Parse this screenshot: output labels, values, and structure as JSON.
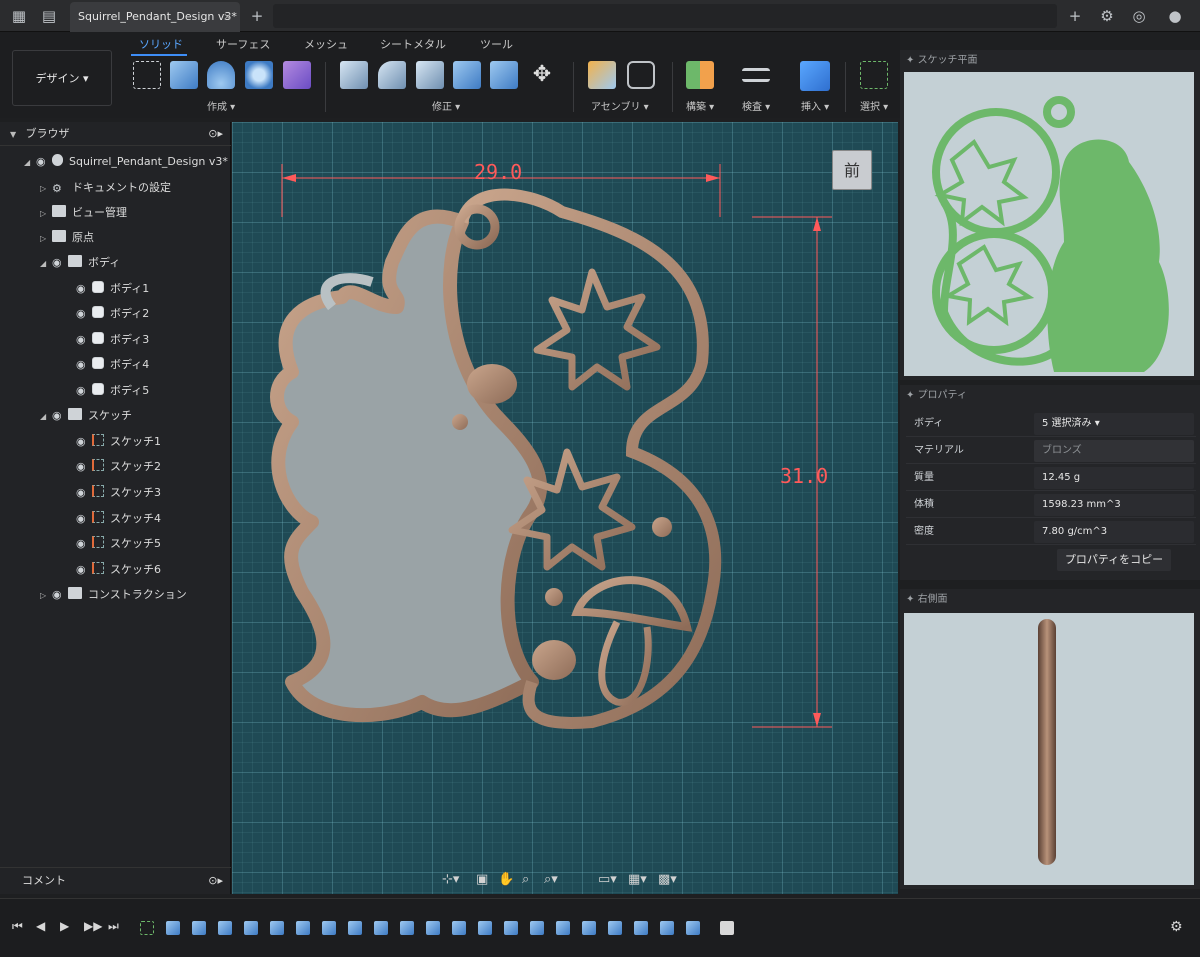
{
  "titlebar": {
    "tab_title": "Squirrel_Pendant_Design v3*",
    "tab_close": "×",
    "add_tab": "+",
    "grid_icon": "grid-icon",
    "file_icon": "file-icon",
    "settings_icon": "gear-icon",
    "profile_icon": "user-icon"
  },
  "ribbon": {
    "workspace_label": "デザイン ▾",
    "tabs": [
      {
        "label": "ソリッド",
        "active": true
      },
      {
        "label": "サーフェス",
        "active": false
      },
      {
        "label": "メッシュ",
        "active": false
      },
      {
        "label": "シートメタル",
        "active": false
      },
      {
        "label": "ツール",
        "active": false
      }
    ],
    "groups": [
      {
        "label": "作成 ▾"
      },
      {
        "label": "修正 ▾"
      },
      {
        "label": "アセンブリ ▾"
      },
      {
        "label": "構築 ▾"
      },
      {
        "label": "検査 ▾"
      },
      {
        "label": "挿入 ▾"
      },
      {
        "label": "選択 ▾"
      }
    ]
  },
  "browser": {
    "title": "ブラウザ",
    "root": "Squirrel_Pendant_Design v3*",
    "items": [
      {
        "label": "ドキュメントの設定"
      },
      {
        "label": "ビュー管理"
      },
      {
        "label": "原点"
      },
      {
        "label": "ボディ"
      },
      {
        "label": "ボディ1"
      },
      {
        "label": "ボディ2"
      },
      {
        "label": "ボディ3"
      },
      {
        "label": "ボディ4"
      },
      {
        "label": "ボディ5"
      },
      {
        "label": "スケッチ"
      },
      {
        "label": "スケッチ1"
      },
      {
        "label": "スケッチ2"
      },
      {
        "label": "スケッチ3"
      },
      {
        "label": "スケッチ4"
      },
      {
        "label": "スケッチ5"
      },
      {
        "label": "スケッチ6"
      },
      {
        "label": "コンストラクション"
      }
    ],
    "comment": "コメント"
  },
  "viewport": {
    "viewcube_label": "前",
    "dim_width": "29.0",
    "dim_height": "31.0"
  },
  "panels": {
    "sketch_plane_title": "スケッチ平面",
    "properties_title": "プロパティ",
    "right_side_title": "右側面",
    "properties": [
      {
        "key": "ボディ",
        "value": "5 選択済み ▾"
      },
      {
        "key": "マテリアル",
        "value": "ブロンズ"
      },
      {
        "key": "質量",
        "value": "12.45 g"
      },
      {
        "key": "体積",
        "value": "1598.23 mm^3"
      },
      {
        "key": "密度",
        "value": "7.80 g/cm^3"
      }
    ],
    "copy_button": "プロパティをコピー"
  },
  "colors": {
    "accent": "#3e8ef7",
    "bronze": "#b8927a",
    "sketch_green": "#6db86a",
    "dimension": "#ff5a5a"
  }
}
